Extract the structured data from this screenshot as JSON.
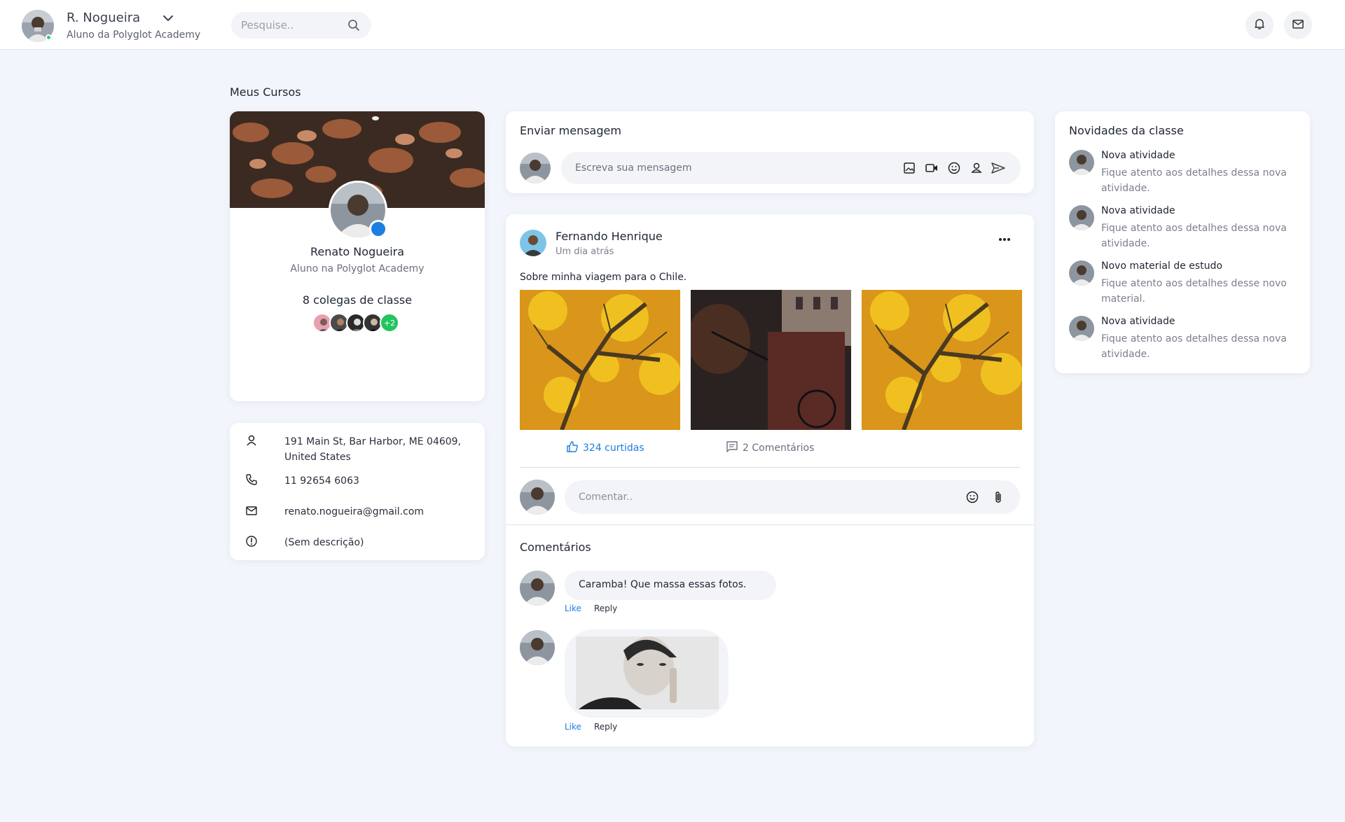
{
  "topbar": {
    "user_name": "R. Nogueira",
    "user_subtitle": "Aluno da Polyglot Academy",
    "search_placeholder": "Pesquise.."
  },
  "courses": {
    "section_title": "Meus Cursos"
  },
  "profile": {
    "name": "Renato Nogueira",
    "subtitle": "Aluno na Polyglot Academy",
    "colleagues_label": "8 colegas de classe",
    "more_count": "+2"
  },
  "contact": {
    "address": "191 Main St, Bar Harbor, ME 04609, United States",
    "phone": "11 92654 6063",
    "email": "renato.nogueira@gmail.com",
    "description": "(Sem descrição)"
  },
  "send_message": {
    "title": "Enviar mensagem",
    "placeholder": "Escreva sua mensagem"
  },
  "post": {
    "author": "Fernando Henrique",
    "time": "Um dia atrás",
    "text": "Sobre minha viagem para o Chile.",
    "likes_label": "324 curtidas",
    "comments_label": "2 Comentários",
    "comment_placeholder": "Comentar..",
    "comments_title": "Comentários",
    "comments": [
      {
        "text": "Caramba! Que massa essas fotos.",
        "like": "Like",
        "reply": "Reply"
      },
      {
        "like": "Like",
        "reply": "Reply"
      }
    ]
  },
  "news": {
    "title": "Novidades da classe",
    "items": [
      {
        "title": "Nova atividade",
        "desc": "Fique atento aos detalhes dessa nova atividade."
      },
      {
        "title": "Nova atividade",
        "desc": "Fique atento aos detalhes dessa nova atividade."
      },
      {
        "title": "Novo material de estudo",
        "desc": "Fique atento aos detalhes desse novo material."
      },
      {
        "title": "Nova atividade",
        "desc": "Fique atento aos detalhes dessa nova atividade."
      }
    ]
  },
  "colors": {
    "background": "#f2f5fb",
    "accent_blue": "#1b7fe2",
    "online_green": "#2ecc71",
    "more_badge_green": "#22c55e"
  }
}
